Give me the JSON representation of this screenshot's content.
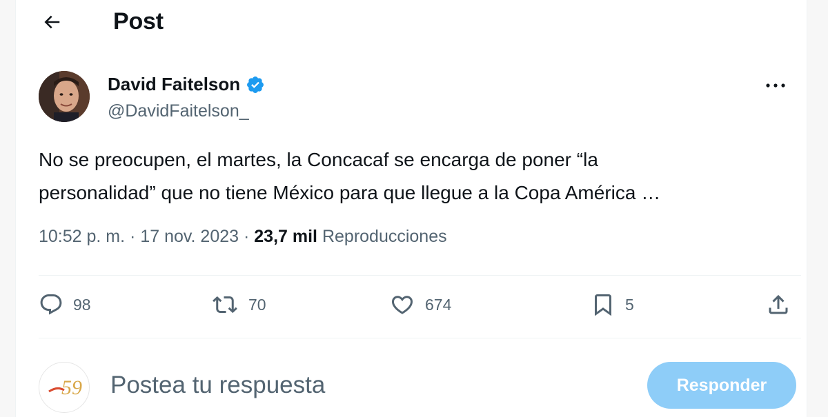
{
  "header": {
    "title": "Post"
  },
  "tweet": {
    "author_name": "David Faitelson",
    "author_handle": "@DavidFaitelson_",
    "verified": true,
    "text_lines": [
      "No se preocupen, el martes, la Concacaf se encarga de poner “la",
      "personalidad” que no tiene México para que llegue a la Copa América …"
    ],
    "time": "10:52 p. m.",
    "date": "17 nov. 2023",
    "views_count": "23,7 mil",
    "views_label": "Reproducciones"
  },
  "actions": {
    "replies": "98",
    "reposts": "70",
    "likes": "674",
    "bookmarks": "5"
  },
  "reply": {
    "placeholder": "Postea tu respuesta",
    "button_label": "Responder",
    "avatar_text": "59"
  },
  "icons": {
    "back": "arrow-left-icon",
    "verified": "verified-badge-icon",
    "more": "more-horizontal-icon",
    "reply": "reply-icon",
    "repost": "repost-icon",
    "like": "heart-icon",
    "bookmark": "bookmark-icon",
    "share": "share-icon"
  },
  "colors": {
    "accent": "#1d9bf0",
    "button_disabled": "#8ecdf8",
    "secondary_text": "#536471",
    "primary_text": "#0f1419"
  }
}
